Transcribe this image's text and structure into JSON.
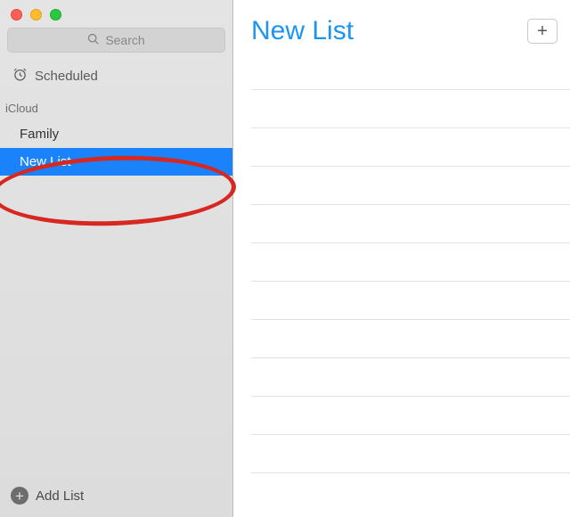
{
  "window": {
    "search_placeholder": "Search",
    "scheduled_label": "Scheduled"
  },
  "section": {
    "header": "iCloud",
    "lists": [
      {
        "label": "Family",
        "selected": false
      },
      {
        "label": "New List",
        "selected": true
      }
    ]
  },
  "sidebar": {
    "add_label": "Add List"
  },
  "main": {
    "title": "New List",
    "row_count": 11
  },
  "colors": {
    "selection": "#1a82fb",
    "title": "#1a95f3",
    "annotation": "#d62820"
  }
}
